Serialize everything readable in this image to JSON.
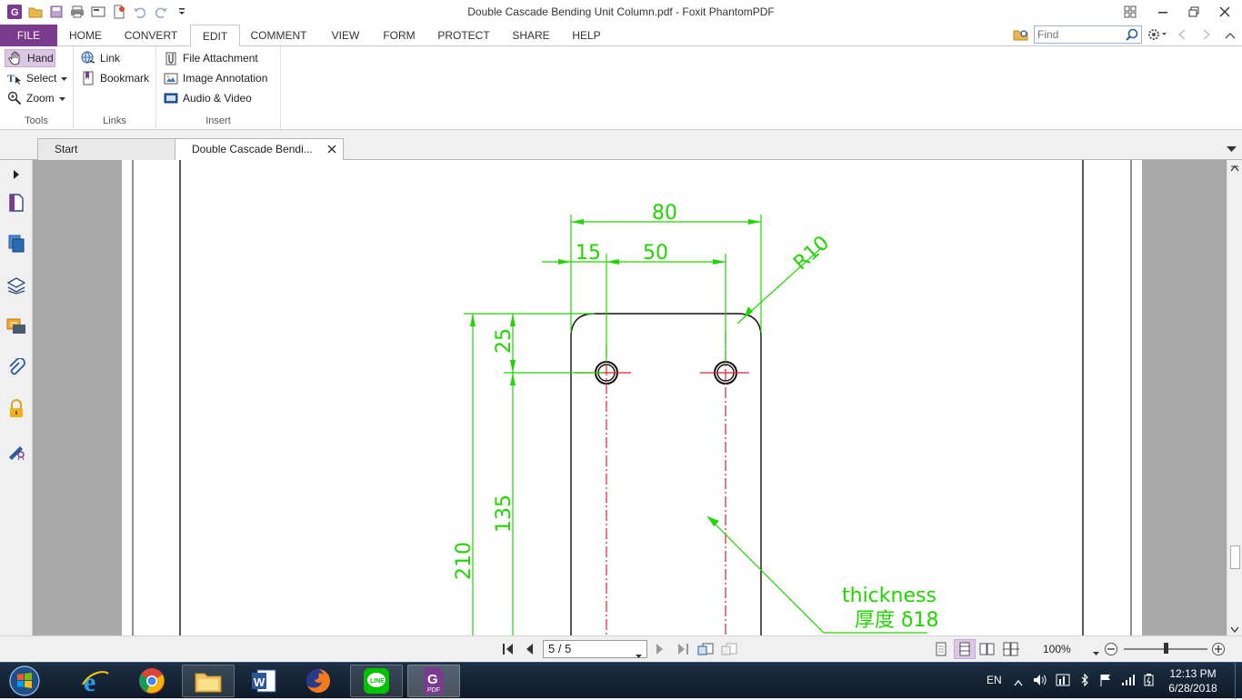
{
  "window": {
    "title": "Double Cascade Bending Unit Column.pdf - Foxit PhantomPDF"
  },
  "menu": {
    "tabs": [
      "FILE",
      "HOME",
      "CONVERT",
      "EDIT",
      "COMMENT",
      "VIEW",
      "FORM",
      "PROTECT",
      "SHARE",
      "HELP"
    ],
    "active": "EDIT"
  },
  "search": {
    "placeholder": "Find"
  },
  "ribbon": {
    "tools": {
      "label": "Tools",
      "hand": "Hand",
      "select": "Select",
      "zoom": "Zoom"
    },
    "links": {
      "label": "Links",
      "link": "Link",
      "bookmark": "Bookmark"
    },
    "insert": {
      "label": "Insert",
      "file_attachment": "File Attachment",
      "image_annotation": "Image Annotation",
      "audio_video": "Audio & Video"
    }
  },
  "doc_tabs": [
    {
      "label": "Start",
      "active": false
    },
    {
      "label": "Double Cascade Bendi...",
      "active": true
    }
  ],
  "drawing": {
    "dim_width": "80",
    "dim_left": "15",
    "dim_hole_spacing": "50",
    "dim_radius": "R10",
    "dim_top_offset": "25",
    "dim_slot": "135",
    "dim_height": "210",
    "note_en": "thickness",
    "note_cn": "厚度 δ18",
    "colors": {
      "dimension": "#22d400",
      "outline": "#111111",
      "centerline": "#e0202a"
    }
  },
  "status": {
    "page_indicator": "5 / 5",
    "zoom": "100%",
    "zoom_level": 0.5
  },
  "taskbar": {
    "language": "EN",
    "time": "12:13 PM",
    "date": "6/28/2018",
    "apps": [
      "internet-explorer",
      "chrome",
      "file-explorer",
      "word",
      "firefox",
      "line",
      "foxit-phantompdf"
    ]
  }
}
